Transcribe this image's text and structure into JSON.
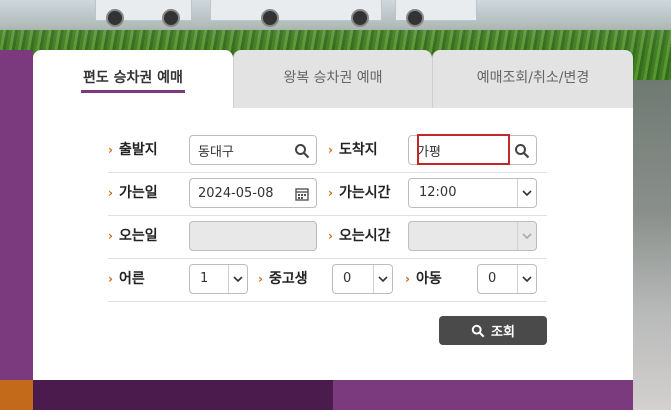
{
  "tabs": [
    {
      "label": "편도 승차권 예매",
      "active": true
    },
    {
      "label": "왕복 승차권 예매",
      "active": false
    },
    {
      "label": "예매조회/취소/변경",
      "active": false
    }
  ],
  "form": {
    "departure": {
      "label": "출발지",
      "value": "동대구"
    },
    "arrival": {
      "label": "도착지",
      "value": "가평"
    },
    "depart_date": {
      "label": "가는일",
      "value": "2024-05-08"
    },
    "depart_time": {
      "label": "가는시간",
      "value": "12:00"
    },
    "return_date": {
      "label": "오는일",
      "value": ""
    },
    "return_time": {
      "label": "오는시간",
      "value": ""
    },
    "adult": {
      "label": "어른",
      "value": "1"
    },
    "teen": {
      "label": "중고생",
      "value": "0"
    },
    "child": {
      "label": "아동",
      "value": "0"
    },
    "search_label": "조회"
  },
  "colors": {
    "brand_purple": "#7b3a7e",
    "accent_orange": "#d06a14",
    "highlight": "#c0282a"
  }
}
